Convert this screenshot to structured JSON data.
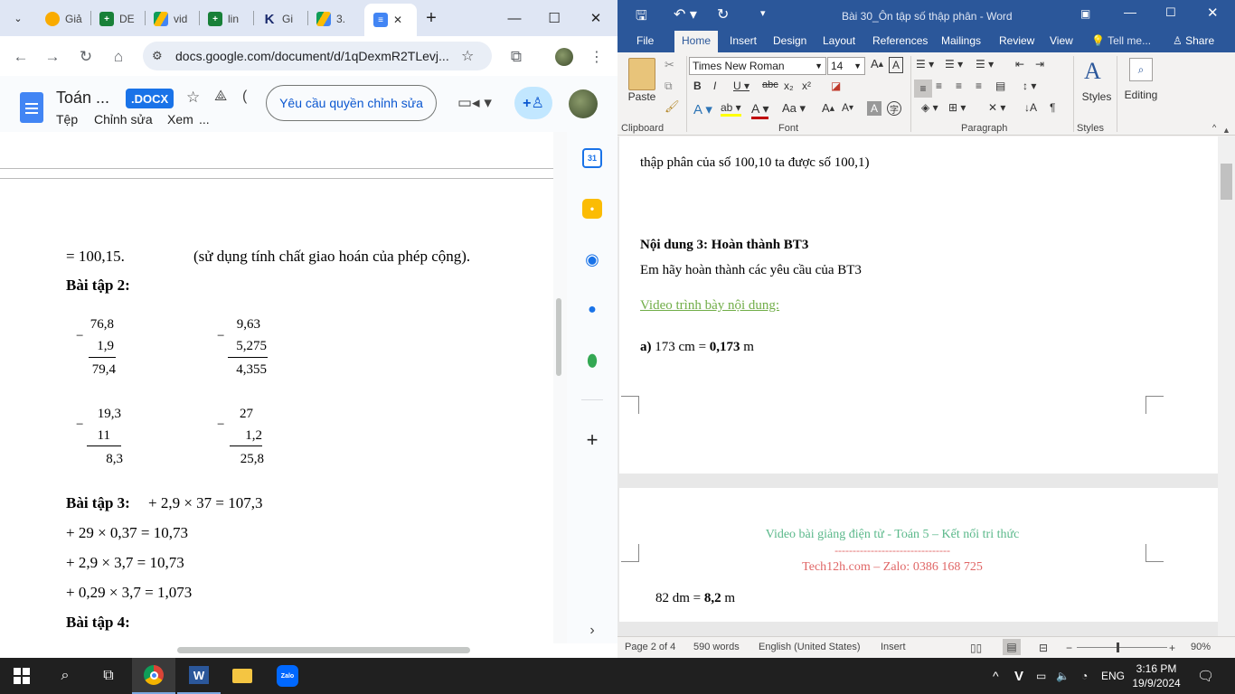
{
  "chrome": {
    "tabs": [
      {
        "label": "Giả",
        "color": "#f9ab00"
      },
      {
        "label": "DE",
        "color": "#188038"
      },
      {
        "label": "vid",
        "color": "#1a73e8"
      },
      {
        "label": "lin",
        "color": "#188038"
      },
      {
        "label": "Gi",
        "color": "#1a2a6c"
      },
      {
        "label": "3.",
        "color": "#1a73e8"
      }
    ],
    "active_tab_close": "✕",
    "new_tab": "+",
    "url": "docs.google.com/document/d/1qDexmR2TLevj...",
    "doc_title": "Toán ...",
    "doc_badge": ".DOCX",
    "menu": [
      "Tệp",
      "Chỉnh sửa",
      "Xem",
      "..."
    ],
    "request_edit_label": "Yêu cầu quyền chỉnh sửa",
    "content": {
      "line1_left": "= 100,15.",
      "line1_right": "(sử dụng tính chất giao hoán của phép cộng).",
      "bt2_title": "Bài tập 2:",
      "sub1": {
        "op": "−",
        "a": "76,8",
        "b": "1,9",
        "r": "79,4"
      },
      "sub2": {
        "op": "−",
        "a": "9,63",
        "b": "5,275",
        "r": "4,355"
      },
      "sub3": {
        "op": "−",
        "a": "19,3",
        "b": "11",
        "r": "8,3"
      },
      "sub4": {
        "op": "−",
        "a": "27",
        "b": "1,2",
        "r": "25,8"
      },
      "bt3_title": "Bài tập 3:",
      "bt3_l1": "+ 2,9 × 37 = 107,3",
      "bt3_l2": "+ 29 × 0,37 = 10,73",
      "bt3_l3": "+ 2,9 × 3,7 = 10,73",
      "bt3_l4": "+ 0,29 × 3,7 = 1,073",
      "bt4_title": "Bài tập 4:"
    },
    "side_calendar_label": "31"
  },
  "word": {
    "title": "Bài 30_Ôn tập số thập phân - Word",
    "tabs": [
      "File",
      "Home",
      "Insert",
      "Design",
      "Layout",
      "References",
      "Mailings",
      "Review",
      "View"
    ],
    "tell_me": "Tell me...",
    "share": "Share",
    "font_name": "Times New Roman",
    "font_size": "14",
    "groups": [
      "Clipboard",
      "Font",
      "Paragraph",
      "Styles"
    ],
    "paste_label": "Paste",
    "styles_label": "Styles",
    "editing_label": "Editing",
    "page1": {
      "line1": "thập phân của số 100,10 ta được số 100,1)",
      "heading": "Nội dung 3: Hoàn thành BT3",
      "line2": "Em hãy hoàn thành các yêu cầu của BT3",
      "link": "Video trình bày nội dung:",
      "a_label": "a)",
      "a_text": "173 cm =",
      "a_answer": "0,173",
      "a_unit": "m"
    },
    "page2": {
      "footer1": "Video bài giảng điện tử - Toán 5 – Kết nối tri thức",
      "footer_sep": "--------------------------------",
      "footer2": "Tech12h.com – Zalo: 0386 168 725",
      "line1_text": "82 dm =",
      "line1_answer": "8,2",
      "line1_unit": "m"
    },
    "status": {
      "page": "Page 2 of 4",
      "words": "590 words",
      "lang": "English (United States)",
      "mode": "Insert",
      "zoom": "90%"
    },
    "colors": {
      "brand": "#2b579a",
      "link": "#70ad47",
      "footer_green": "#5ab88a",
      "footer_red": "#e06666"
    }
  },
  "taskbar": {
    "input_lang": "V",
    "lang": "ENG",
    "time": "3:16 PM",
    "date": "19/9/2024",
    "zalo": "Zalo"
  }
}
